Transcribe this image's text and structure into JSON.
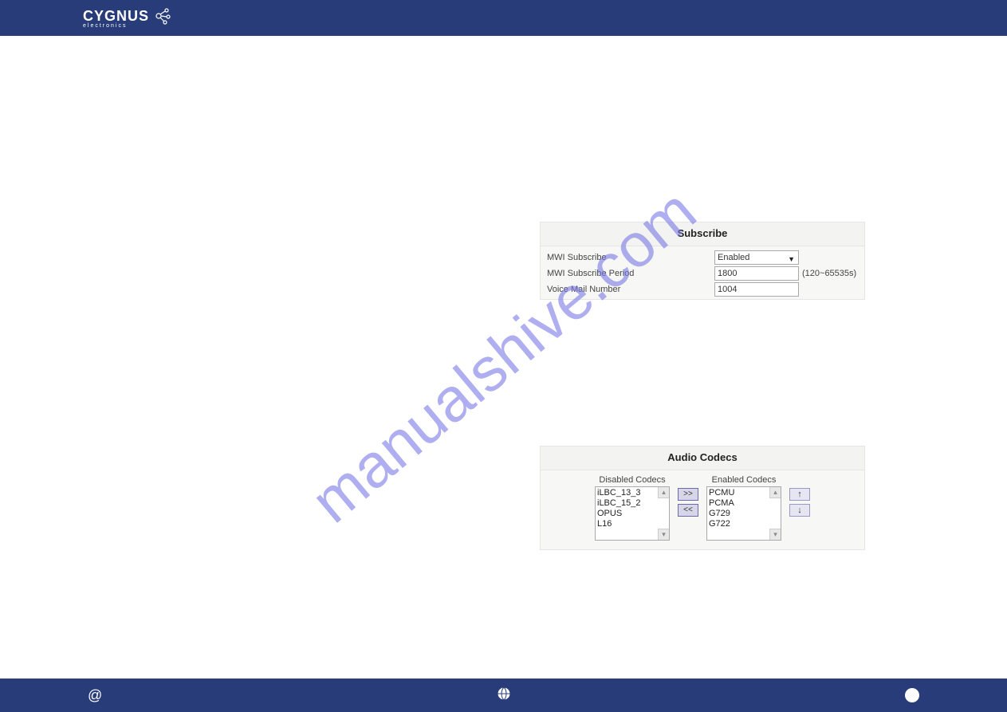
{
  "header": {
    "brand": "CYGNUS",
    "brand_sub": "electronics"
  },
  "watermark": "manualshive.com",
  "subscribe": {
    "title": "Subscribe",
    "mwi_label": "MWI Subscribe",
    "mwi_value": "Enabled",
    "period_label": "MWI Subscribe Period",
    "period_value": "1800",
    "period_hint": "(120~65535s)",
    "voicemail_label": "Voice Mail Number",
    "voicemail_value": "1004"
  },
  "codecs": {
    "title": "Audio Codecs",
    "disabled_title": "Disabled Codecs",
    "enabled_title": "Enabled Codecs",
    "disabled": [
      "iLBC_13_3",
      "iLBC_15_2",
      "OPUS",
      "L16"
    ],
    "enabled": [
      "PCMU",
      "PCMA",
      "G729",
      "G722"
    ],
    "btn_right": ">>",
    "btn_left": "<<",
    "btn_up": "↑",
    "btn_down": "↓"
  }
}
